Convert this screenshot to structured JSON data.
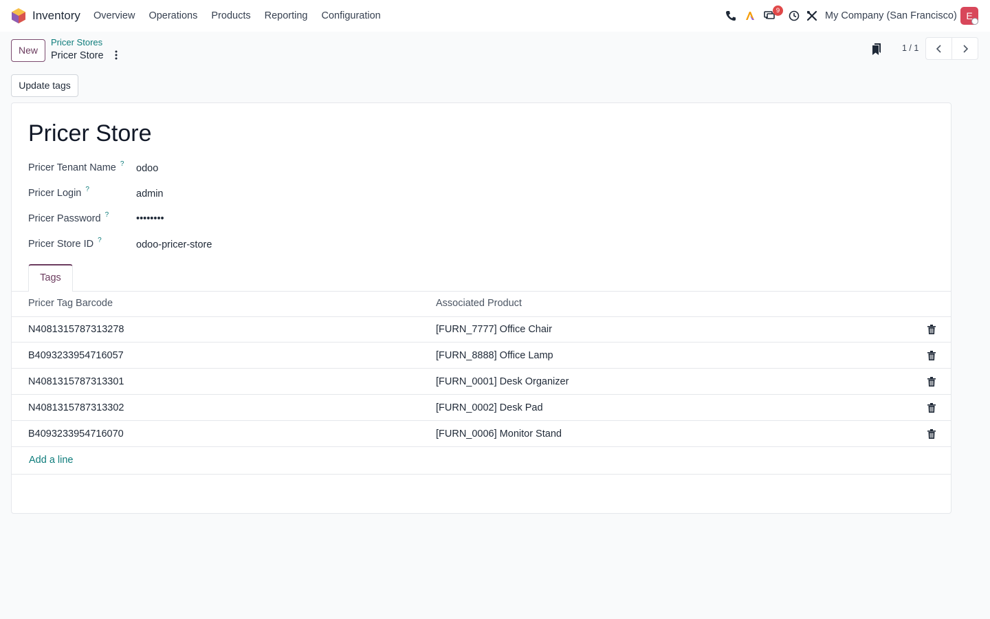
{
  "navbar": {
    "app_name": "Inventory",
    "menu": [
      "Overview",
      "Operations",
      "Products",
      "Reporting",
      "Configuration"
    ],
    "messages_badge": "9",
    "company": "My Company (San Francisco)",
    "avatar_initial": "E",
    "icons": [
      "phone-icon",
      "ai-icon",
      "messages-icon",
      "clock-icon",
      "tools-icon"
    ]
  },
  "control": {
    "new_label": "New",
    "breadcrumb_parent": "Pricer Stores",
    "breadcrumb_current": "Pricer Store",
    "pager": "1 / 1",
    "update_tags_label": "Update tags"
  },
  "form": {
    "title": "Pricer Store",
    "fields": [
      {
        "label": "Pricer Tenant Name",
        "value": "odoo"
      },
      {
        "label": "Pricer Login",
        "value": "admin"
      },
      {
        "label": "Pricer Password",
        "value": "••••••••"
      },
      {
        "label": "Pricer Store ID",
        "value": "odoo-pricer-store"
      }
    ],
    "help_mark": "?",
    "tab_label": "Tags",
    "columns": [
      "Pricer Tag Barcode",
      "Associated Product"
    ],
    "rows": [
      {
        "barcode": "N4081315787313278",
        "product": "[FURN_7777] Office Chair"
      },
      {
        "barcode": "B4093233954716057",
        "product": "[FURN_8888] Office Lamp"
      },
      {
        "barcode": "N4081315787313301",
        "product": "[FURN_0001] Desk Organizer"
      },
      {
        "barcode": "N4081315787313302",
        "product": "[FURN_0002] Desk Pad"
      },
      {
        "barcode": "B4093233954716070",
        "product": "[FURN_0006] Monitor Stand"
      }
    ],
    "add_line_label": "Add a line"
  },
  "colors": {
    "brand": "#6b3b5e",
    "link": "#0e7c7b",
    "badge": "#e04848",
    "avatar": "#d8475a"
  }
}
